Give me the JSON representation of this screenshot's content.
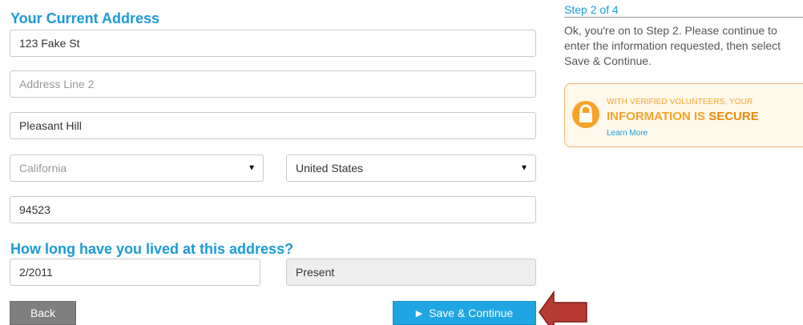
{
  "address": {
    "heading": "Your Current Address",
    "line1_value": "123 Fake St",
    "line2_placeholder": "Address Line 2",
    "city_value": "Pleasant Hill",
    "state_value": "California",
    "country_value": "United States",
    "zip_value": "94523"
  },
  "duration": {
    "heading": "How long have you lived at this address?",
    "from_value": "2/2011",
    "to_value": "Present"
  },
  "buttons": {
    "back_label": "Back",
    "save_label": "Save & Continue"
  },
  "sidebar": {
    "step_title": "Step 2 of 4",
    "step_text": "Ok, you're on to Step 2. Please continue to enter the information requested, then select Save & Continue.",
    "secure_line1": "WITH VERIFIED VOLUNTEERS, YOUR",
    "secure_line2_prefix": "INFORMATION IS ",
    "secure_line2_emph": "SECURE",
    "learn_more": "Learn More"
  },
  "colors": {
    "accent": "#1a9bd7",
    "save_button": "#1fa5e2",
    "back_button": "#7f7f7f",
    "secure_orange": "#f7a328",
    "annotation_arrow": "#b83a34"
  },
  "icons": {
    "lock": "lock-icon",
    "dropdown": "triangle-down-icon",
    "play": "play-icon",
    "annotation": "arrow-left-icon"
  }
}
